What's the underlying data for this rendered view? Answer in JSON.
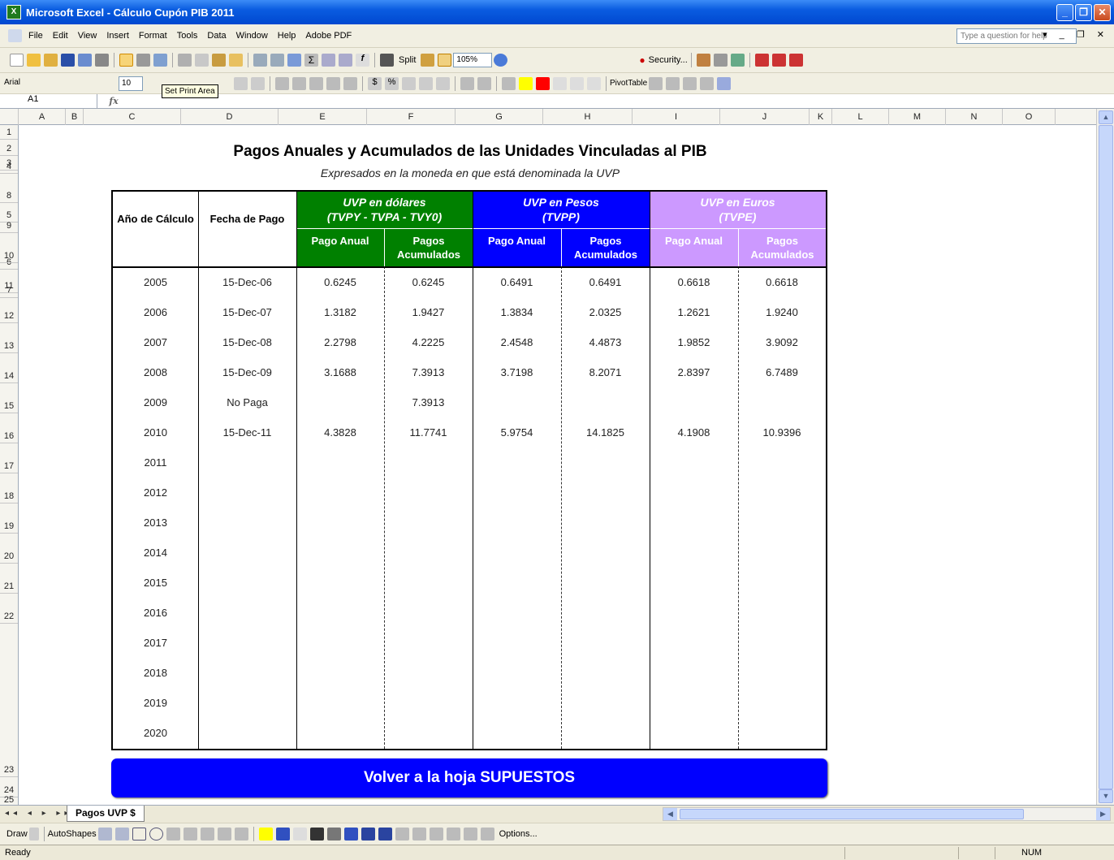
{
  "window": {
    "title": "Microsoft Excel - Cálculo Cupón PIB 2011",
    "app_icon": "excel-icon"
  },
  "menu": {
    "items": [
      "File",
      "Edit",
      "View",
      "Insert",
      "Format",
      "Tools",
      "Data",
      "Window",
      "Help",
      "Adobe PDF"
    ],
    "help_placeholder": "Type a question for help"
  },
  "toolbar": {
    "split_label": "Split",
    "zoom": "105%",
    "security_label": "Security...",
    "font": "Arial",
    "font_size": "10",
    "pivot_label": "PivotTable",
    "tooltip": "Set Print Area"
  },
  "formula": {
    "cell": "A1",
    "fx": "fx",
    "content": ""
  },
  "columns": [
    "A",
    "B",
    "C",
    "D",
    "E",
    "F",
    "G",
    "H",
    "I",
    "J",
    "K",
    "L",
    "M",
    "N",
    "O"
  ],
  "rows": [
    "1",
    "2",
    "3",
    "4",
    "5",
    "6",
    "7",
    "8",
    "9",
    "10",
    "11",
    "12",
    "13",
    "14",
    "15",
    "16",
    "17",
    "18",
    "19",
    "20",
    "21",
    "22",
    "23",
    "24",
    "25"
  ],
  "sheet": {
    "title": "Pagos Anuales y Acumulados de las Unidades Vinculadas al PIB",
    "subtitle": "Expresados en la moneda en que está denominada la UVP",
    "header_year": "Año de Cálculo",
    "header_date": "Fecha de Pago",
    "groups": [
      {
        "label": "UVP en dólares",
        "sublabel": "(TVPY - TVPA - TVY0)",
        "color": "#008000"
      },
      {
        "label": "UVP en Pesos",
        "sublabel": "(TVPP)",
        "color": "#0000ff"
      },
      {
        "label": "UVP en Euros",
        "sublabel": "(TVPE)",
        "color": "#cc99ff"
      }
    ],
    "subheaders": [
      "Pago Anual",
      "Pagos Acumulados",
      "Pago Anual",
      "Pagos Acumulados",
      "Pago Anual",
      "Pagos Acumulados"
    ],
    "data": [
      [
        "2005",
        "15-Dec-06",
        "0.6245",
        "0.6245",
        "0.6491",
        "0.6491",
        "0.6618",
        "0.6618"
      ],
      [
        "2006",
        "15-Dec-07",
        "1.3182",
        "1.9427",
        "1.3834",
        "2.0325",
        "1.2621",
        "1.9240"
      ],
      [
        "2007",
        "15-Dec-08",
        "2.2798",
        "4.2225",
        "2.4548",
        "4.4873",
        "1.9852",
        "3.9092"
      ],
      [
        "2008",
        "15-Dec-09",
        "3.1688",
        "7.3913",
        "3.7198",
        "8.2071",
        "2.8397",
        "6.7489"
      ],
      [
        "2009",
        "No Paga",
        "",
        "7.3913",
        "",
        "",
        "",
        ""
      ],
      [
        "2010",
        "15-Dec-11",
        "4.3828",
        "11.7741",
        "5.9754",
        "14.1825",
        "4.1908",
        "10.9396"
      ],
      [
        "2011",
        "",
        "",
        "",
        "",
        "",
        "",
        ""
      ],
      [
        "2012",
        "",
        "",
        "",
        "",
        "",
        "",
        ""
      ],
      [
        "2013",
        "",
        "",
        "",
        "",
        "",
        "",
        ""
      ],
      [
        "2014",
        "",
        "",
        "",
        "",
        "",
        "",
        ""
      ],
      [
        "2015",
        "",
        "",
        "",
        "",
        "",
        "",
        ""
      ],
      [
        "2016",
        "",
        "",
        "",
        "",
        "",
        "",
        ""
      ],
      [
        "2017",
        "",
        "",
        "",
        "",
        "",
        "",
        ""
      ],
      [
        "2018",
        "",
        "",
        "",
        "",
        "",
        "",
        ""
      ],
      [
        "2019",
        "",
        "",
        "",
        "",
        "",
        "",
        ""
      ],
      [
        "2020",
        "",
        "",
        "",
        "",
        "",
        "",
        ""
      ]
    ],
    "button": "Volver a la hoja SUPUESTOS"
  },
  "tabs": {
    "active": "Pagos UVP $"
  },
  "drawbar": {
    "draw": "Draw",
    "autoshapes": "AutoShapes",
    "options": "Options..."
  },
  "status": {
    "left": "Ready",
    "num": "NUM"
  }
}
